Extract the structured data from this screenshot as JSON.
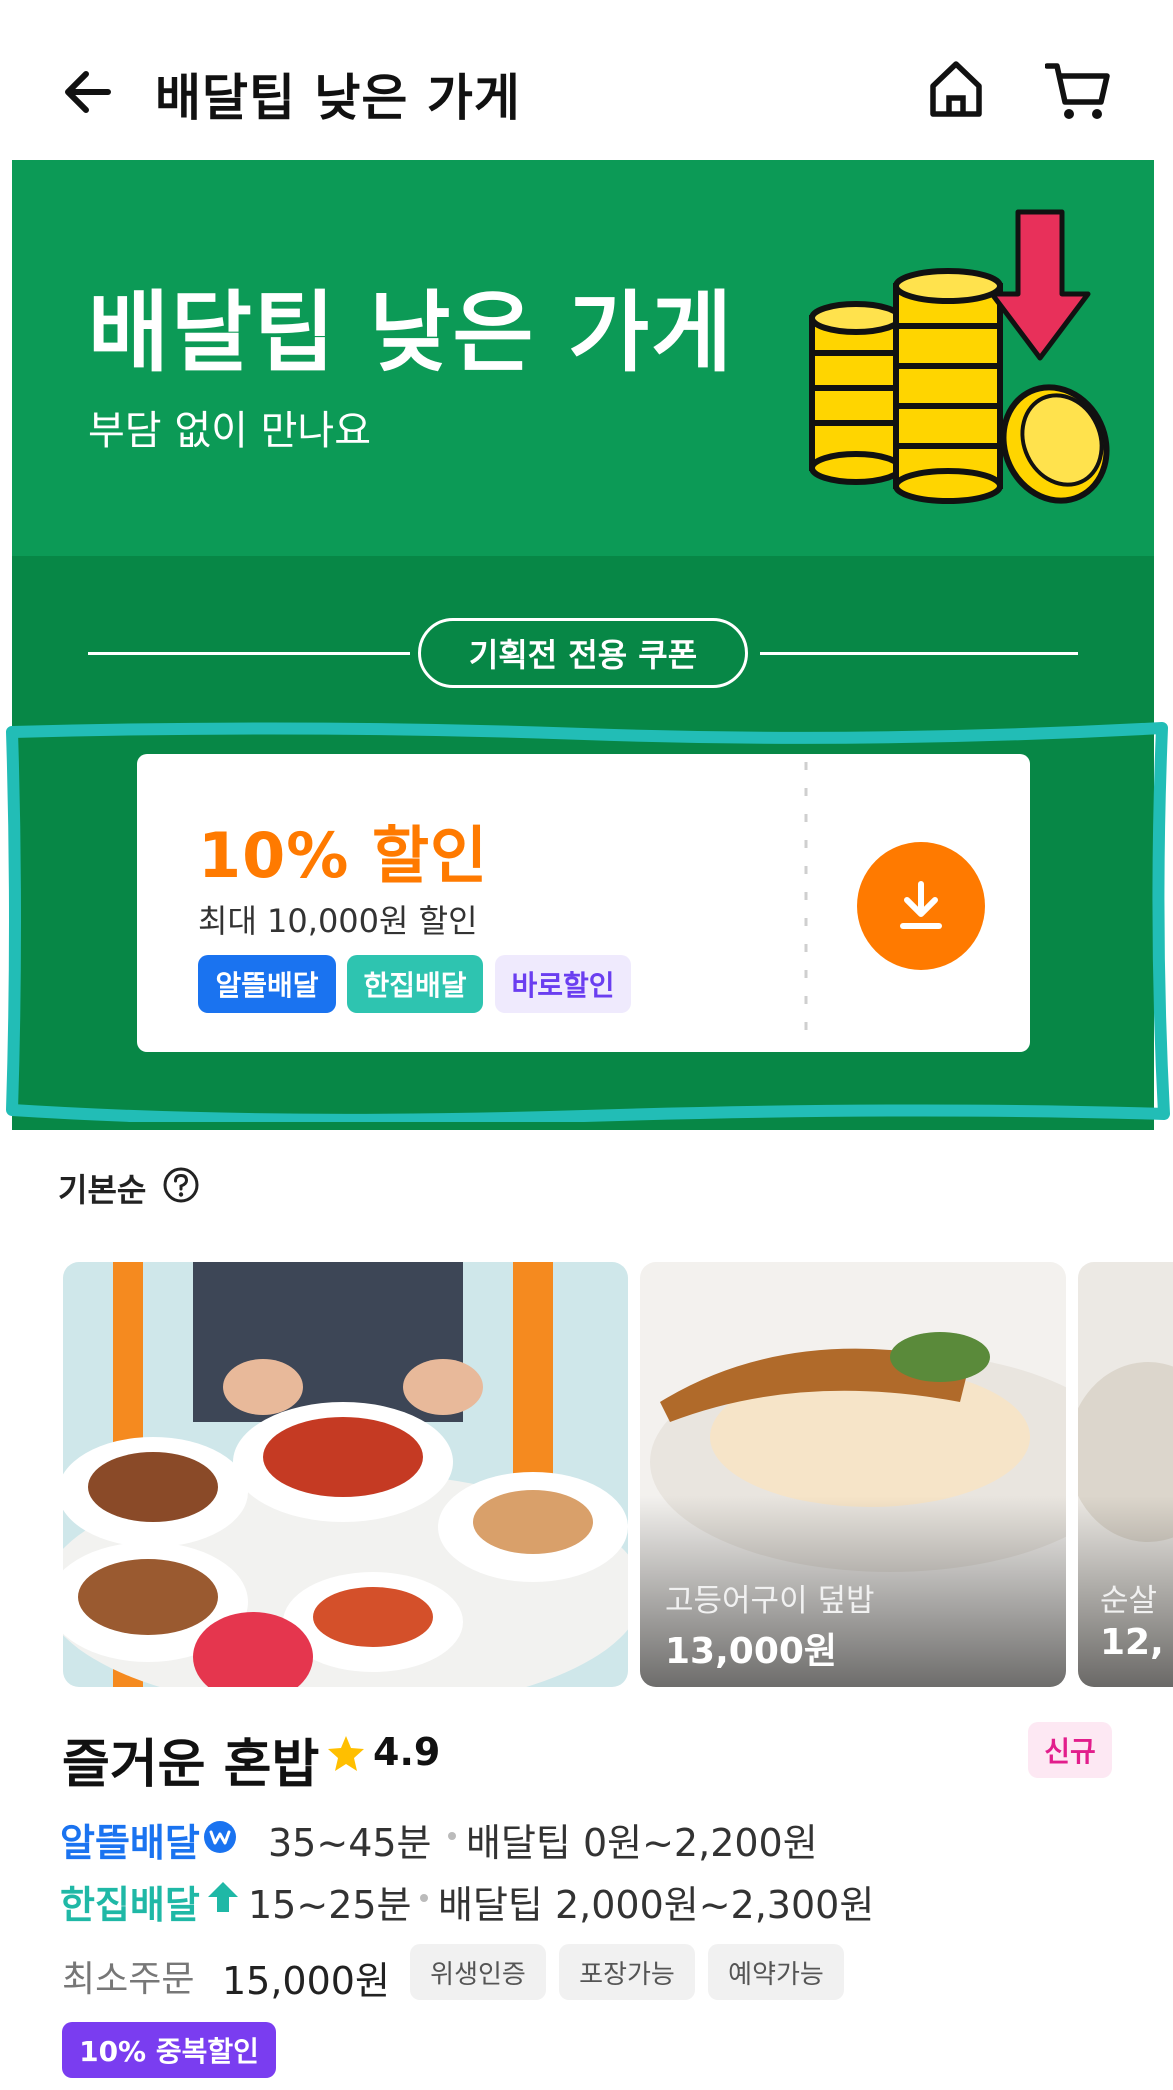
{
  "header": {
    "title": "배달팁 낮은 가게",
    "icons": [
      "back-arrow-icon",
      "home-icon",
      "cart-icon"
    ]
  },
  "banner": {
    "title": "배달팁 낮은 가게",
    "subtitle": "부담 없이 만나요",
    "illustration": "coins-down-arrow-illustration",
    "background": "#0c9a56"
  },
  "coupon_section": {
    "heading": "기획전 전용 쿠폰",
    "coupon": {
      "discount": "10% 할인",
      "max": "최대 10,000원 할인",
      "tags": [
        "알뜰배달",
        "한집배달",
        "바로할인"
      ],
      "download_icon": "download-icon",
      "accent": "#ff7a00"
    }
  },
  "sort": {
    "label": "기본순",
    "help_icon": "question-circle-icon"
  },
  "store": {
    "images": [
      {
        "name": "",
        "price": ""
      },
      {
        "name": "고등어구이 덮밥",
        "price": "13,000원"
      },
      {
        "name": "순살",
        "price": "12,"
      }
    ],
    "name": "즐거운 혼밥",
    "rating": "4.9",
    "badge": "신규",
    "deliveries": [
      {
        "type": "알뜰배달",
        "time": "35~45분",
        "tip": "배달팁 0원~2,200원"
      },
      {
        "type": "한집배달",
        "time": "15~25분",
        "tip": "배달팁 2,000원~2,300원"
      }
    ],
    "min_order_label": "최소주문",
    "min_order_value": "15,000원",
    "chips": [
      "위생인증",
      "포장가능",
      "예약가능"
    ],
    "promo": "10% 중복할인"
  }
}
